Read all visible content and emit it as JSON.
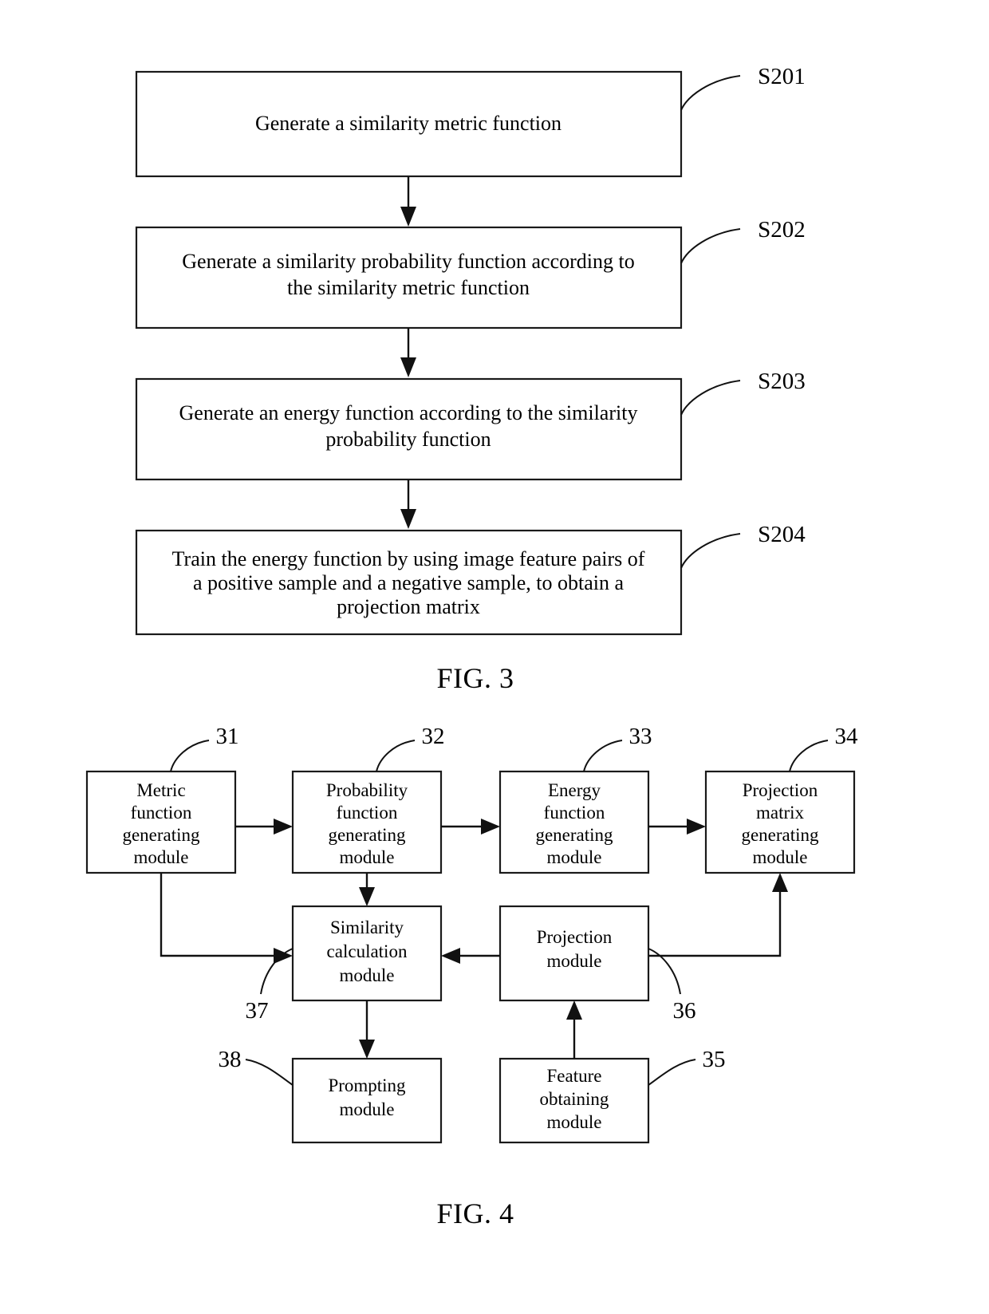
{
  "document": {
    "type": "patent-drawing-sheet",
    "figures": [
      {
        "caption": "FIG. 3",
        "kind": "flowchart",
        "steps": [
          {
            "ref": "S201",
            "lines": [
              "Generate a similarity metric function"
            ]
          },
          {
            "ref": "S202",
            "lines": [
              "Generate a similarity probability function according to",
              "the similarity metric function"
            ]
          },
          {
            "ref": "S203",
            "lines": [
              "Generate an energy function according to the similarity",
              "probability function"
            ]
          },
          {
            "ref": "S204",
            "lines": [
              "Train the energy function by using image feature pairs of",
              "a positive sample and a negative sample, to obtain a",
              "projection matrix"
            ]
          }
        ]
      },
      {
        "caption": "FIG. 4",
        "kind": "block-diagram",
        "modules": [
          {
            "ref": "31",
            "lines": [
              "Metric",
              "function",
              "generating",
              "module"
            ]
          },
          {
            "ref": "32",
            "lines": [
              "Probability",
              "function",
              "generating",
              "module"
            ]
          },
          {
            "ref": "33",
            "lines": [
              "Energy",
              "function",
              "generating",
              "module"
            ]
          },
          {
            "ref": "34",
            "lines": [
              "Projection",
              "matrix",
              "generating",
              "module"
            ]
          },
          {
            "ref": "37",
            "lines": [
              "Similarity",
              "calculation",
              "module"
            ]
          },
          {
            "ref": "36",
            "lines": [
              "Projection",
              "module"
            ]
          },
          {
            "ref": "38",
            "lines": [
              "Prompting",
              "module"
            ]
          },
          {
            "ref": "35",
            "lines": [
              "Feature",
              "obtaining",
              "module"
            ]
          }
        ]
      }
    ]
  },
  "fig3": {
    "caption": "FIG. 3",
    "s201_ref": "S201",
    "s202_ref": "S202",
    "s203_ref": "S203",
    "s204_ref": "S204",
    "s201_l1": "Generate a similarity metric function",
    "s202_l1": "Generate a similarity probability function according to",
    "s202_l2": "the similarity metric function",
    "s203_l1": "Generate an energy function according to the similarity",
    "s203_l2": "probability function",
    "s204_l1": "Train the energy function by using image feature pairs of",
    "s204_l2": "a positive sample and a negative sample, to obtain a",
    "s204_l3": "projection matrix"
  },
  "fig4": {
    "caption": "FIG. 4",
    "m31_ref": "31",
    "m31_l1": "Metric",
    "m31_l2": "function",
    "m31_l3": "generating",
    "m31_l4": "module",
    "m32_ref": "32",
    "m32_l1": "Probability",
    "m32_l2": "function",
    "m32_l3": "generating",
    "m32_l4": "module",
    "m33_ref": "33",
    "m33_l1": "Energy",
    "m33_l2": "function",
    "m33_l3": "generating",
    "m33_l4": "module",
    "m34_ref": "34",
    "m34_l1": "Projection",
    "m34_l2": "matrix",
    "m34_l3": "generating",
    "m34_l4": "module",
    "m37_ref": "37",
    "m37_l1": "Similarity",
    "m37_l2": "calculation",
    "m37_l3": "module",
    "m36_ref": "36",
    "m36_l1": "Projection",
    "m36_l2": "module",
    "m38_ref": "38",
    "m38_l1": "Prompting",
    "m38_l2": "module",
    "m35_ref": "35",
    "m35_l1": "Feature",
    "m35_l2": "obtaining",
    "m35_l3": "module"
  },
  "colors": {
    "ink": "#111111",
    "paper": "#ffffff"
  }
}
